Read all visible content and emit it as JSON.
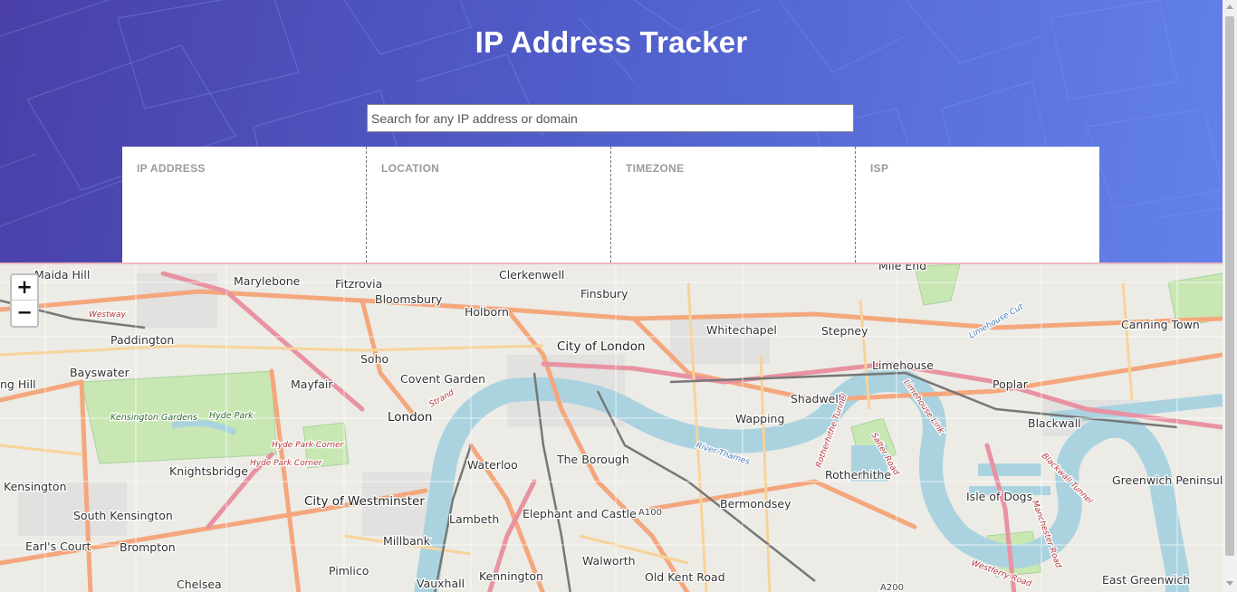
{
  "header": {
    "title": "IP Address Tracker",
    "search_placeholder": "Search for any IP address or domain",
    "search_value": ""
  },
  "info": [
    {
      "label": "IP ADDRESS",
      "value": ""
    },
    {
      "label": "LOCATION",
      "value": ""
    },
    {
      "label": "TIMEZONE",
      "value": ""
    },
    {
      "label": "ISP",
      "value": ""
    }
  ],
  "map": {
    "zoom_in_label": "+",
    "zoom_out_label": "−",
    "places": {
      "maida_hill": "Maida Hill",
      "marylebone": "Marylebone",
      "fitzrovia": "Fitzrovia",
      "bloomsbury": "Bloomsbury",
      "clerkenwell": "Clerkenwell",
      "finsbury": "Finsbury",
      "mile_end": "Mile End",
      "westway": "Westway",
      "holborn": "Holborn",
      "paddington": "Paddington",
      "whitechapel": "Whitechapel",
      "stepney": "Stepney",
      "canning_town": "Canning Town",
      "city_of_london": "City of London",
      "soho": "Soho",
      "bayswater": "Bayswater",
      "covent_garden": "Covent Garden",
      "limehouse": "Limehouse",
      "ng_hill": "ng Hill",
      "mayfair": "Mayfair",
      "poplar": "Poplar",
      "shadwell": "Shadwell",
      "kensington_gardens": "Kensington Gardens",
      "hyde_park": "Hyde Park",
      "london": "London",
      "wapping": "Wapping",
      "blackwall": "Blackwall",
      "hyde_park_corner": "Hyde Park Corner",
      "knightsbridge": "Knightsbridge",
      "waterloo": "Waterloo",
      "the_borough": "The Borough",
      "rotherhithe": "Rotherhithe",
      "greenwich_peninsula": "Greenwich Peninsula",
      "kensington": "Kensington",
      "city_of_westminster": "City of Westminster",
      "isle_of_dogs": "Isle of Dogs",
      "bermondsey": "Bermondsey",
      "south_kensington": "South Kensington",
      "lambeth": "Lambeth",
      "elephant_and_castle": "Elephant and Castle",
      "a100": "A100",
      "earls_court": "Earl's Court",
      "brompton": "Brompton",
      "millbank": "Millbank",
      "walworth": "Walworth",
      "pimlico": "Pimlico",
      "kennington": "Kennington",
      "old_kent_road": "Old Kent Road",
      "chelsea": "Chelsea",
      "vauxhall": "Vauxhall",
      "a200": "A200",
      "east_greenwich": "East Greenwich",
      "river_thames": "River Thames",
      "strand": "Strand",
      "rotherhithe_tunnel": "Rotherhithe Tunnel",
      "salter_road": "Salter Road",
      "limehouse_link": "Limehouse Link",
      "limehouse_cut": "Limehouse Cut",
      "blackwall_tunnel": "Blackwall Tunnel",
      "manchester_road": "Manchester Road",
      "westferry_road": "Westferry Road"
    }
  },
  "colors": {
    "header_gradient_start": "#4a3fa8",
    "header_gradient_end": "#6381ea",
    "label_gray": "#9b9b9b",
    "map_background": "#ecebe6",
    "river": "#aad3df",
    "park": "#c8e7b3",
    "major_road": "#f4a77d"
  }
}
